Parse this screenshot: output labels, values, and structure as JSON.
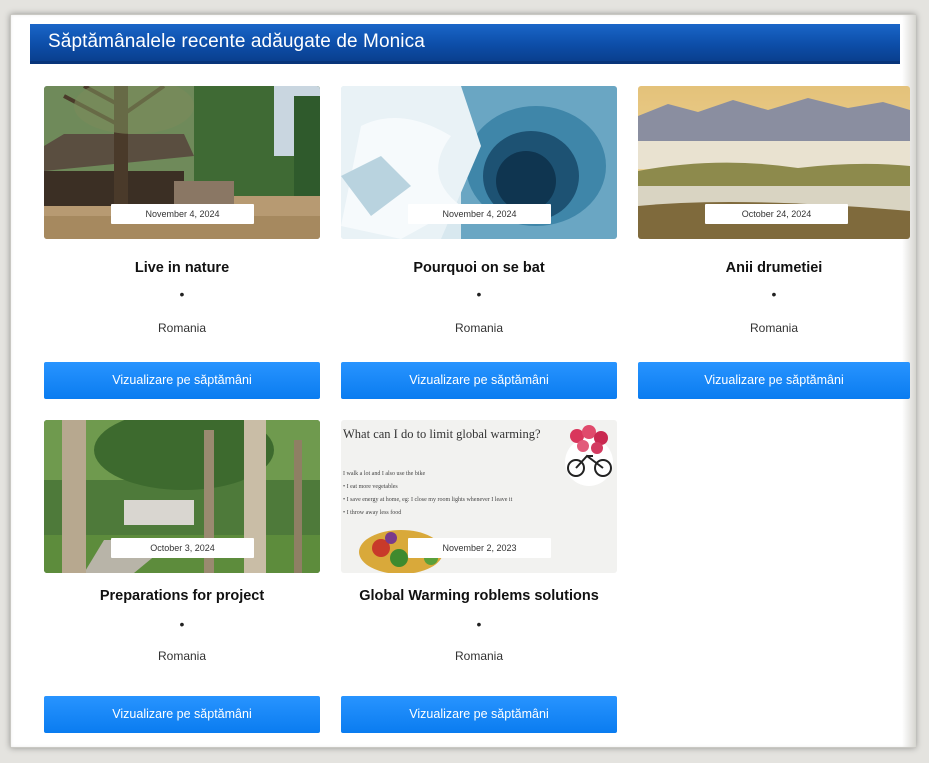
{
  "header": {
    "title": "Săptămânalele recente adăugate de Monica"
  },
  "cards": [
    {
      "date": "November 4, 2024",
      "title": "Live in nature",
      "dot": "•",
      "country": "Romania",
      "button": "Vizualizare pe săptămâni"
    },
    {
      "date": "November 4, 2024",
      "title": "Pourquoi on se bat",
      "dot": "•",
      "country": "Romania",
      "button": "Vizualizare pe săptămâni"
    },
    {
      "date": "October 24, 2024",
      "title": "Anii drumetiei",
      "dot": "•",
      "country": "Romania",
      "button": "Vizualizare pe săptămâni"
    },
    {
      "date": "October 3, 2024",
      "title": "Preparations for project",
      "dot": "•",
      "country": "Romania",
      "button": "Vizualizare pe săptămâni"
    },
    {
      "date": "November 2, 2023",
      "title": "Global Warming roblems solutions",
      "dot": "•",
      "country": "Romania",
      "button": "Vizualizare pe săptămâni",
      "image_text": {
        "heading": "What can I do to limit global warming?",
        "lines": [
          "I walk a lot and I also use the bike",
          "• I eat more vegetables",
          "• I save energy at home, eg: I close my room lights whenever I leave it",
          "• I throw away less food"
        ]
      }
    }
  ]
}
